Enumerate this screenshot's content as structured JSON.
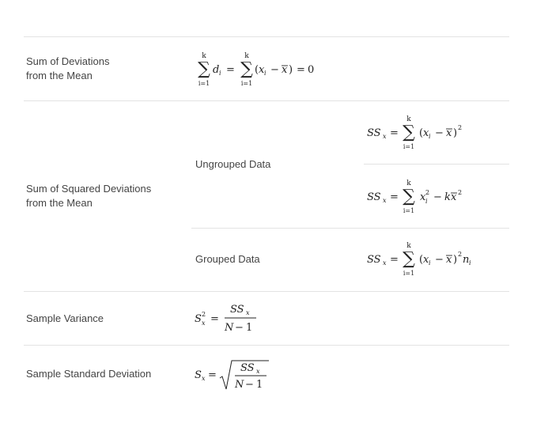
{
  "rows": {
    "sum_deviations": {
      "label_line1": "Sum of Deviations",
      "label_line2": "from the Mean",
      "formula": "∑_{i=1}^{k} d_i = ∑_{i=1}^{k}(x_i − x̄) = 0"
    },
    "sum_squared": {
      "label_line1": "Sum of Squared Deviations",
      "label_line2": "from the Mean",
      "ungrouped_label": "Ungrouped Data",
      "ungrouped_formula_1": "SS_x = ∑_{i=1}^{k}(x_i − x̄)^2",
      "ungrouped_formula_2": "SS_x = ∑_{i=1}^{k} x_i^2 − k x̄^2",
      "grouped_label": "Grouped Data",
      "grouped_formula": "SS_x = ∑_{i=1}^{k}(x_i − x̄)^2 n_i"
    },
    "sample_variance": {
      "label": "Sample Variance",
      "formula": "S_x^2 = SS_x / (N − 1)"
    },
    "sample_sd": {
      "label": "Sample Standard Deviation",
      "formula": "S_x = √(SS_x / (N − 1))"
    }
  },
  "glyphs": {
    "sigma": "∑",
    "eq": "=",
    "minus": "−",
    "xbar": "x̄",
    "lparen": "(",
    "rparen": ")",
    "zero": "0",
    "one": "1",
    "two": "2",
    "k": "k",
    "i_eq_1": "i=1",
    "d": "d",
    "i": "i",
    "x": "x",
    "SS": "SS",
    "S": "S",
    "N": "N",
    "n": "n"
  }
}
